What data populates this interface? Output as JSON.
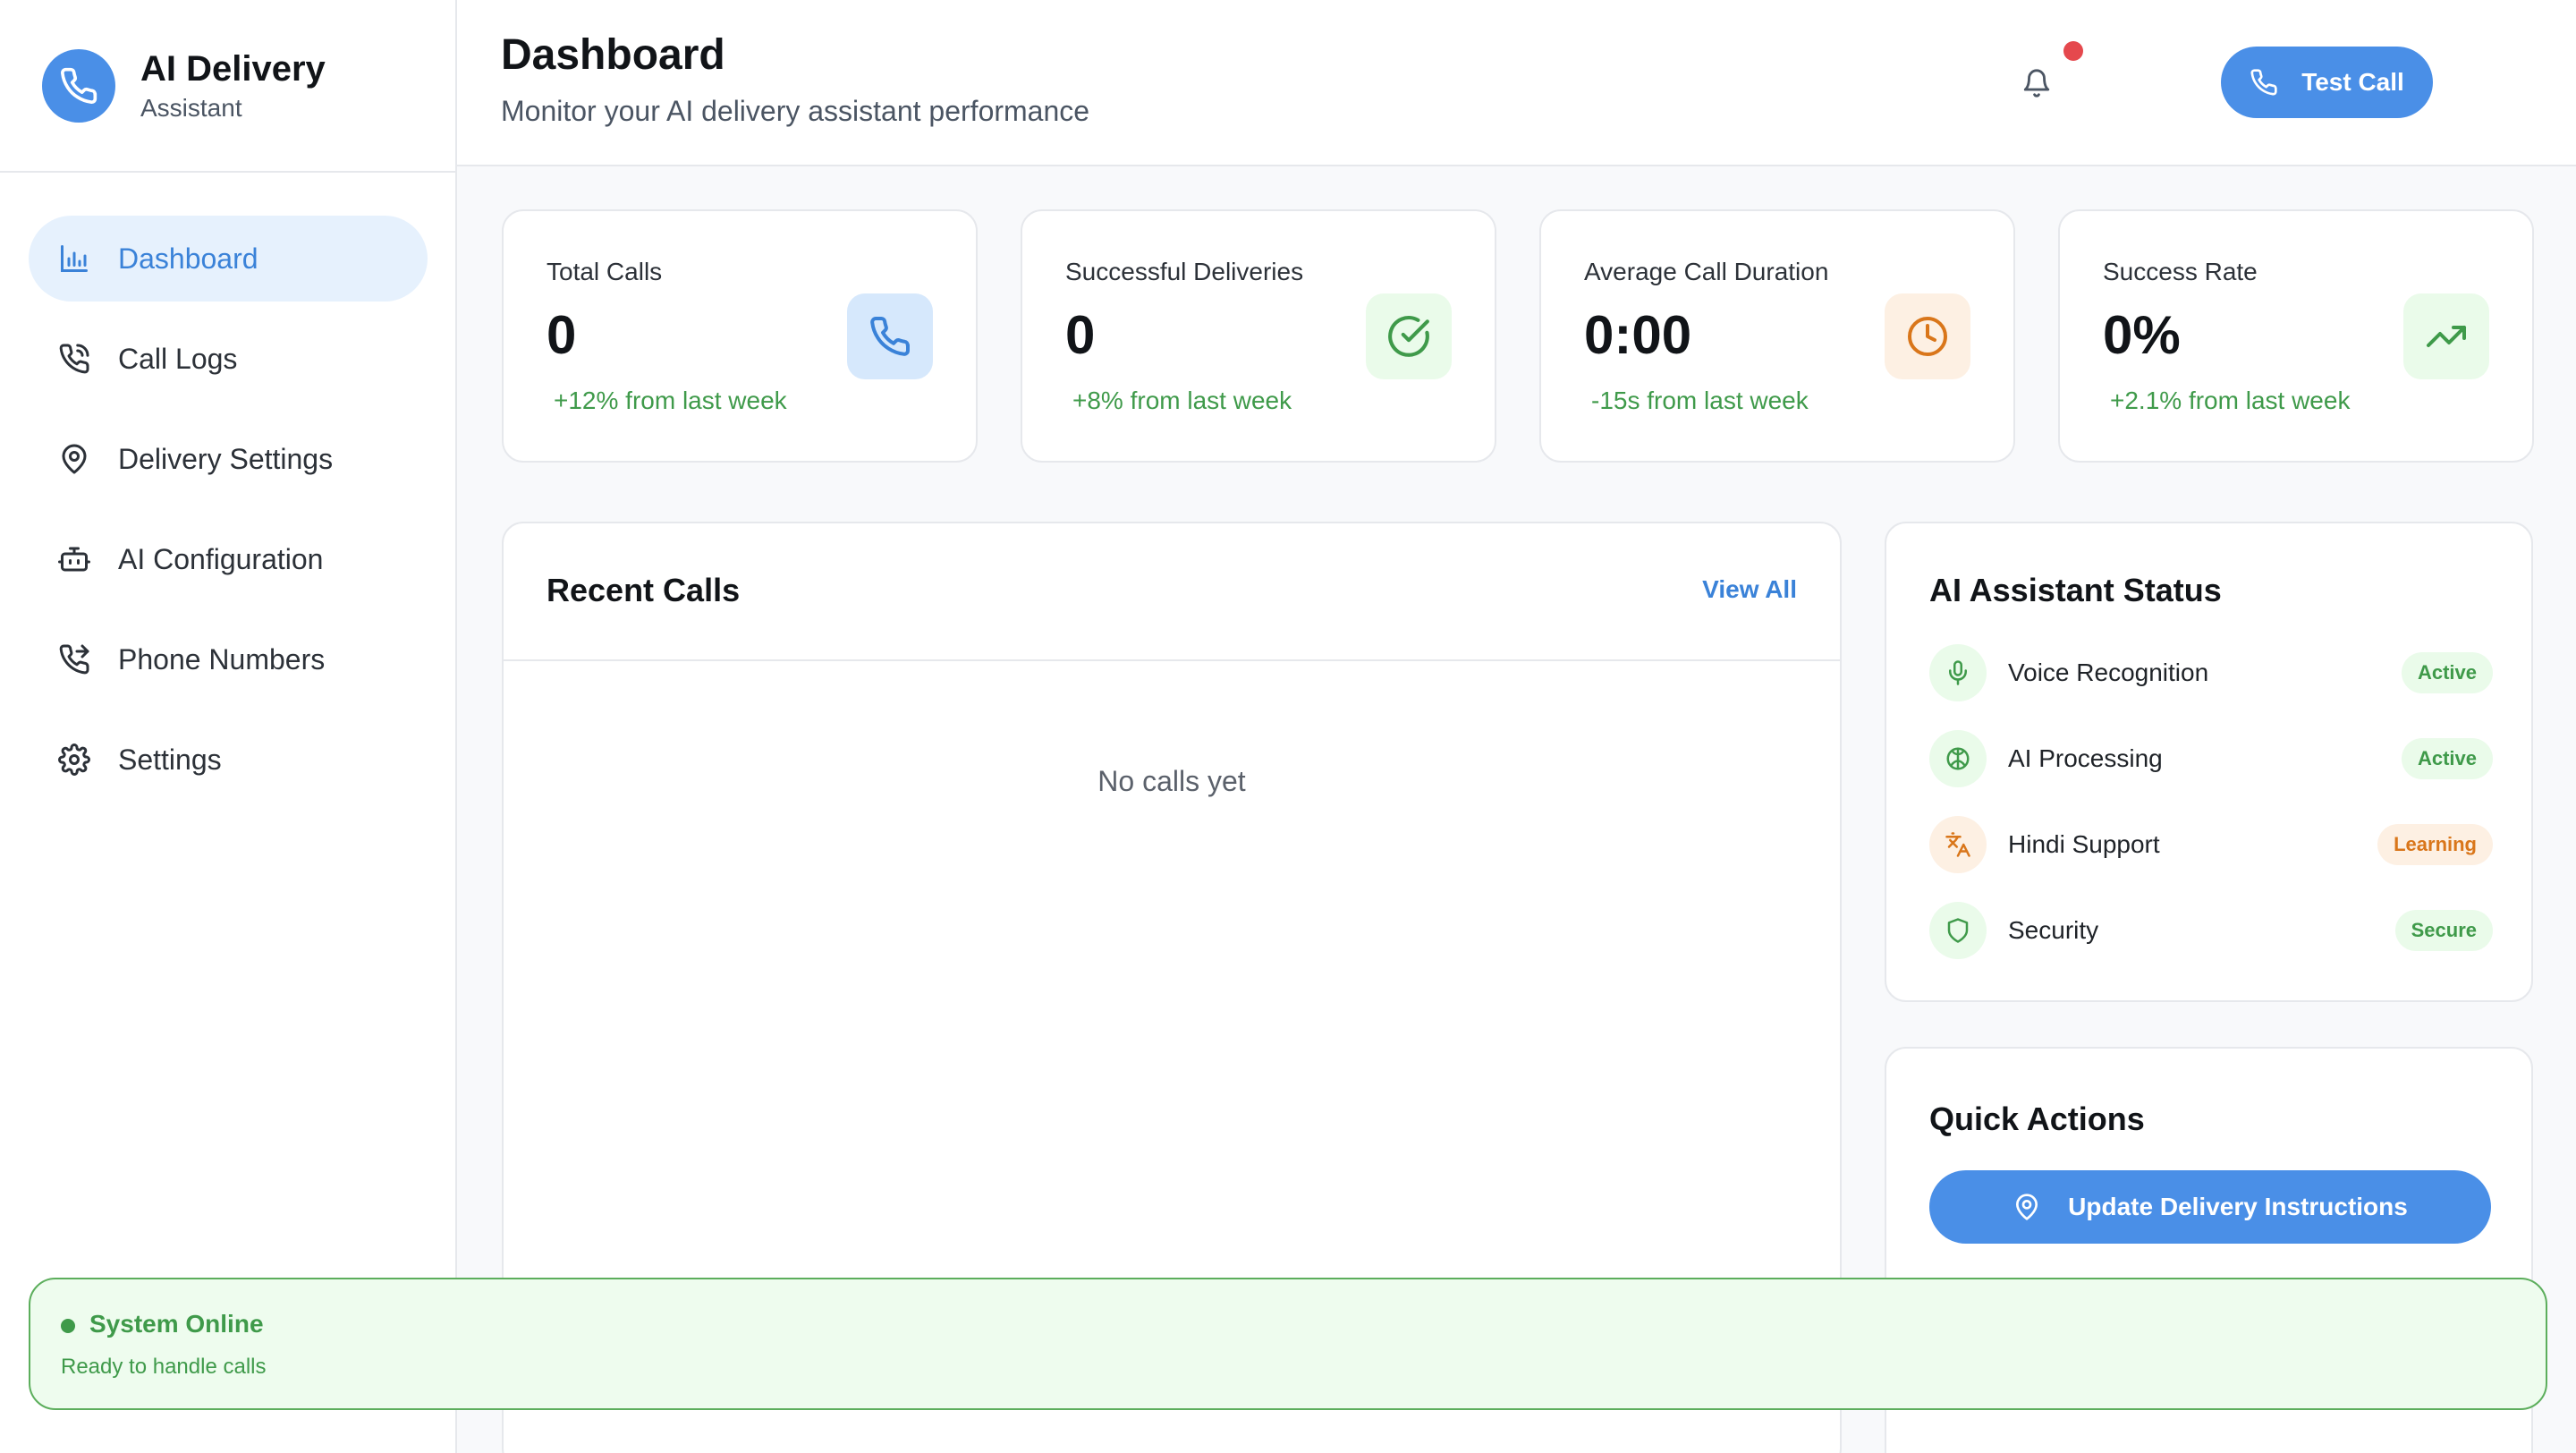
{
  "brand": {
    "title": "AI Delivery",
    "subtitle": "Assistant",
    "logo_icon": "phone-icon"
  },
  "sidebar": {
    "items": [
      {
        "label": "Dashboard",
        "icon": "bar-chart-icon",
        "active": true
      },
      {
        "label": "Call Logs",
        "icon": "phone-call-icon"
      },
      {
        "label": "Delivery Settings",
        "icon": "map-pin-icon"
      },
      {
        "label": "AI Configuration",
        "icon": "bot-icon"
      },
      {
        "label": "Phone Numbers",
        "icon": "phone-forwarded-icon"
      },
      {
        "label": "Settings",
        "icon": "gear-icon"
      }
    ]
  },
  "header": {
    "title": "Dashboard",
    "subtitle": "Monitor your AI delivery assistant performance",
    "test_call_label": "Test Call",
    "notification_dot": true
  },
  "stats": [
    {
      "label": "Total Calls",
      "value": "0",
      "trend": "+12% from last week",
      "icon": "phone-icon",
      "icon_color": "#3a82d8",
      "icon_bg": "#d6e8fc"
    },
    {
      "label": "Successful Deliveries",
      "value": "0",
      "trend": "+8% from last week",
      "icon": "check-circle-icon",
      "icon_color": "#3f9a4a",
      "icon_bg": "#eafbea"
    },
    {
      "label": "Average Call Duration",
      "value": "0:00",
      "trend": "-15s from last week",
      "icon": "clock-icon",
      "icon_color": "#d9761a",
      "icon_bg": "#fdf0e3"
    },
    {
      "label": "Success Rate",
      "value": "0%",
      "trend": "+2.1% from last week",
      "icon": "trending-up-icon",
      "icon_color": "#3f9a4a",
      "icon_bg": "#eafbea"
    }
  ],
  "recent_calls": {
    "title": "Recent Calls",
    "view_all": "View All",
    "empty_text": "No calls yet"
  },
  "status_panel": {
    "title": "AI Assistant Status",
    "items": [
      {
        "name": "Voice Recognition",
        "badge": "Active",
        "tone": "green",
        "icon": "microphone-icon"
      },
      {
        "name": "AI Processing",
        "badge": "Active",
        "tone": "green",
        "icon": "brain-icon"
      },
      {
        "name": "Hindi Support",
        "badge": "Learning",
        "tone": "orange",
        "icon": "translate-icon"
      },
      {
        "name": "Security",
        "badge": "Secure",
        "tone": "green",
        "icon": "shield-icon"
      }
    ]
  },
  "quick_actions": {
    "title": "Quick Actions",
    "primary_label": "Update Delivery Instructions",
    "primary_icon": "map-pin-icon"
  },
  "system": {
    "title": "System Online",
    "subtitle": "Ready to handle calls"
  },
  "colors": {
    "accent": "#4a8fe7",
    "success": "#3f9a4a",
    "warning": "#d9761a",
    "alert": "#e5484d"
  }
}
